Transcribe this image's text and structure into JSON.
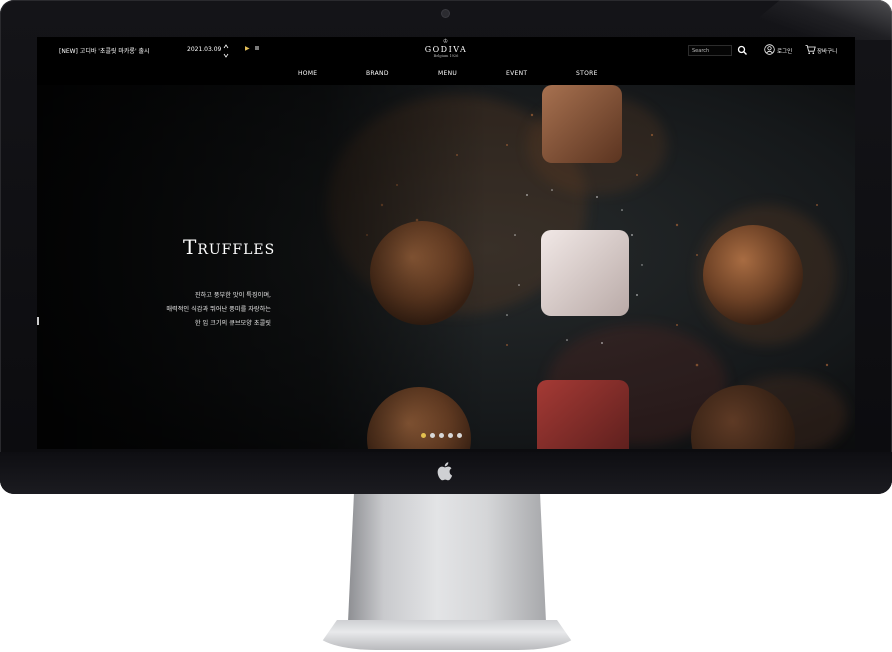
{
  "topbar": {
    "notice": "[NEW] 고디바 '초콜릿 마카롱' 출시",
    "notice_date": "2021.03.09",
    "play_symbol": "▶",
    "logo_crest": "♔",
    "logo_text": "GODIVA",
    "logo_sub": "Belgium 1926",
    "search_placeholder": "Search",
    "login_label": "로그인",
    "cart_label": "장바구니"
  },
  "nav": {
    "items": [
      "HOME",
      "BRAND",
      "MENU",
      "EVENT",
      "STORE"
    ]
  },
  "hero": {
    "title": "Truffles",
    "desc_lines": [
      "진하고 풍부한 맛이 특징이며,",
      "매력적인 식감과 뛰어난 풍미를 자랑하는",
      "한 입 크기의 큐브모양 초콜릿"
    ],
    "slide_count": 5,
    "active_slide": 1
  },
  "colors": {
    "accent": "#e3c04f",
    "background": "#000000",
    "cocoa": "#8a5532"
  }
}
